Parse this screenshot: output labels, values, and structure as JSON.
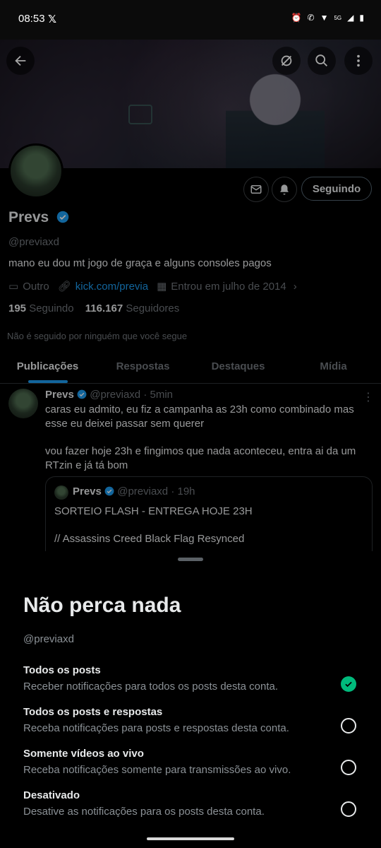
{
  "status_bar": {
    "time": "08:53",
    "network": "5G"
  },
  "profile": {
    "name": "Prevs",
    "handle": "@previaxd",
    "bio": "mano eu dou mt jogo de graça e alguns consoles pagos",
    "category": "Outro",
    "link": "kick.com/previa",
    "joined": "Entrou em julho de 2014",
    "following_count": "195",
    "following_label": "Seguindo",
    "followers_count": "116.167",
    "followers_label": "Seguidores",
    "followed_by_note": "Não é seguido por ninguém que você segue",
    "follow_button": "Seguindo"
  },
  "tabs": [
    {
      "label": "Publicações",
      "active": true
    },
    {
      "label": "Respostas",
      "active": false
    },
    {
      "label": "Destaques",
      "active": false
    },
    {
      "label": "Mídia",
      "active": false
    }
  ],
  "post": {
    "author": "Prevs",
    "handle": "@previaxd",
    "time": "5min",
    "text1": "caras eu admito, eu fiz a campanha as 23h como combinado mas esse eu deixei passar sem querer",
    "text2": "vou fazer hoje 23h e fingimos que nada aconteceu, entra ai da um RTzin e já tá bom",
    "quote": {
      "author": "Prevs",
      "handle": "@previaxd",
      "time": "19h",
      "line1": "SORTEIO FLASH - ENTREGA HOJE 23H",
      "line2": "// Assassins Creed Black Flag Resynced"
    }
  },
  "sheet": {
    "title": "Não perca nada",
    "handle": "@previaxd",
    "options": [
      {
        "title": "Todos os posts",
        "desc": "Receber notificações para todos os posts desta conta.",
        "selected": true
      },
      {
        "title": "Todos os posts e respostas",
        "desc": "Receba notificações para posts e respostas desta conta.",
        "selected": false
      },
      {
        "title": "Somente vídeos ao vivo",
        "desc": "Receba notificações somente para transmissões ao vivo.",
        "selected": false
      },
      {
        "title": "Desativado",
        "desc": "Desative as notificações para os posts desta conta.",
        "selected": false
      }
    ]
  },
  "colors": {
    "accent": "#1d9bf0",
    "check": "#00ba7c"
  }
}
